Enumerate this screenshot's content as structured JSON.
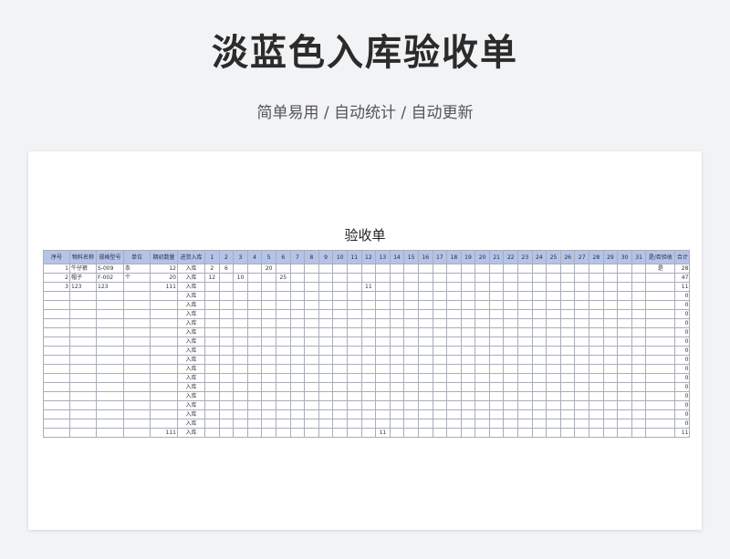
{
  "page": {
    "title": "淡蓝色入库验收单",
    "subtitle": "简单易用 / 自动统计 / 自动更新"
  },
  "sheet": {
    "title": "验收单",
    "headers": {
      "seq": "序号",
      "name": "物料名称",
      "spec": "规格型号",
      "unit": "单位",
      "opening": "期初数量",
      "inout": "进货入库",
      "days": [
        "1",
        "2",
        "3",
        "4",
        "5",
        "6",
        "7",
        "8",
        "9",
        "10",
        "11",
        "12",
        "13",
        "14",
        "15",
        "16",
        "17",
        "18",
        "19",
        "20",
        "21",
        "22",
        "23",
        "24",
        "25",
        "26",
        "27",
        "28",
        "29",
        "30",
        "31"
      ],
      "checked": "是/否验收",
      "total": "合计"
    },
    "rows": [
      {
        "seq": "1",
        "name": "牛仔裤",
        "spec": "S-009",
        "unit": "条",
        "opening": "12",
        "inout": "入库",
        "days": {
          "1": "2",
          "2": "6",
          "5": "20"
        },
        "checked": "是",
        "total": "28"
      },
      {
        "seq": "2",
        "name": "帽子",
        "spec": "F-002",
        "unit": "个",
        "opening": "20",
        "inout": "入库",
        "days": {
          "1": "12",
          "3": "10",
          "6": "25"
        },
        "checked": "",
        "total": "47"
      },
      {
        "seq": "3",
        "name": "123",
        "spec": "123",
        "unit": "",
        "opening": "111",
        "inout": "入库",
        "days": {
          "12": "11"
        },
        "checked": "",
        "total": "11"
      },
      {
        "seq": "",
        "name": "",
        "spec": "",
        "unit": "",
        "opening": "",
        "inout": "入库",
        "days": {},
        "checked": "",
        "total": "0"
      },
      {
        "seq": "",
        "name": "",
        "spec": "",
        "unit": "",
        "opening": "",
        "inout": "入库",
        "days": {},
        "checked": "",
        "total": "0"
      },
      {
        "seq": "",
        "name": "",
        "spec": "",
        "unit": "",
        "opening": "",
        "inout": "入库",
        "days": {},
        "checked": "",
        "total": "0"
      },
      {
        "seq": "",
        "name": "",
        "spec": "",
        "unit": "",
        "opening": "",
        "inout": "入库",
        "days": {},
        "checked": "",
        "total": "0"
      },
      {
        "seq": "",
        "name": "",
        "spec": "",
        "unit": "",
        "opening": "",
        "inout": "入库",
        "days": {},
        "checked": "",
        "total": "0"
      },
      {
        "seq": "",
        "name": "",
        "spec": "",
        "unit": "",
        "opening": "",
        "inout": "入库",
        "days": {},
        "checked": "",
        "total": "0"
      },
      {
        "seq": "",
        "name": "",
        "spec": "",
        "unit": "",
        "opening": "",
        "inout": "入库",
        "days": {},
        "checked": "",
        "total": "0"
      },
      {
        "seq": "",
        "name": "",
        "spec": "",
        "unit": "",
        "opening": "",
        "inout": "入库",
        "days": {},
        "checked": "",
        "total": "0"
      },
      {
        "seq": "",
        "name": "",
        "spec": "",
        "unit": "",
        "opening": "",
        "inout": "入库",
        "days": {},
        "checked": "",
        "total": "0"
      },
      {
        "seq": "",
        "name": "",
        "spec": "",
        "unit": "",
        "opening": "",
        "inout": "入库",
        "days": {},
        "checked": "",
        "total": "0"
      },
      {
        "seq": "",
        "name": "",
        "spec": "",
        "unit": "",
        "opening": "",
        "inout": "入库",
        "days": {},
        "checked": "",
        "total": "0"
      },
      {
        "seq": "",
        "name": "",
        "spec": "",
        "unit": "",
        "opening": "",
        "inout": "入库",
        "days": {},
        "checked": "",
        "total": "0"
      },
      {
        "seq": "",
        "name": "",
        "spec": "",
        "unit": "",
        "opening": "",
        "inout": "入库",
        "days": {},
        "checked": "",
        "total": "0"
      },
      {
        "seq": "",
        "name": "",
        "spec": "",
        "unit": "",
        "opening": "",
        "inout": "入库",
        "days": {},
        "checked": "",
        "total": "0"
      },
      {
        "seq": "",
        "name": "",
        "spec": "",
        "unit": "",
        "opening": "",
        "inout": "入库",
        "days": {},
        "checked": "",
        "total": "0"
      },
      {
        "seq": "",
        "name": "",
        "spec": "",
        "unit": "",
        "opening": "111",
        "inout": "入库",
        "days": {
          "13": "11"
        },
        "checked": "",
        "total": "11"
      }
    ]
  },
  "colors": {
    "header_bg": "#b4c3e6",
    "grid_line": "#a9aeb8",
    "page_bg": "#f2f3f5"
  }
}
